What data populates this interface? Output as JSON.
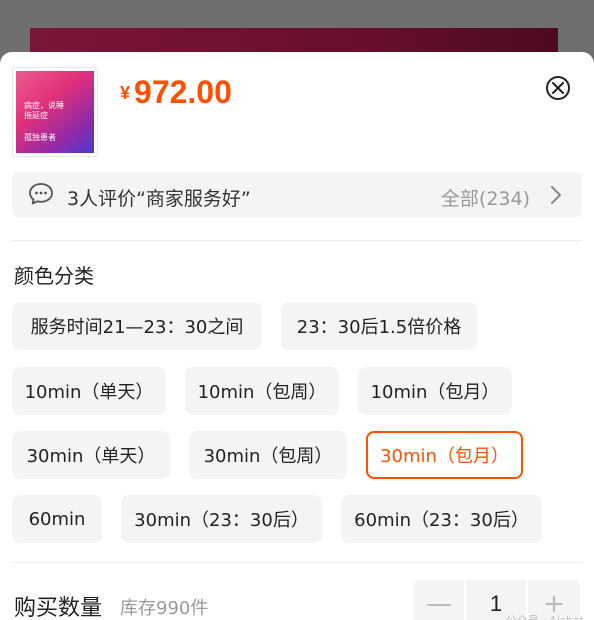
{
  "product": {
    "thumbnail_lines": [
      "病症，说睡",
      "拖延症",
      "孤独患者"
    ],
    "currency": "¥",
    "price": "972.00"
  },
  "review": {
    "text": "3人评价“商家服务好”",
    "all": "全部(234)"
  },
  "color_section": {
    "title": "颜色分类",
    "options": [
      "服务时间21—23：30之间",
      "23：30后1.5倍价格",
      "10min（单天）",
      "10min（包周）",
      "10min（包月）",
      "30min（单天）",
      "30min（包周）",
      "30min（包月）",
      "60min",
      "30min（23：30后）",
      "60min（23：30后）"
    ],
    "selected": "30min（包月）"
  },
  "quantity": {
    "label": "购买数量",
    "stock": "库存990件",
    "minus": "—",
    "value": "1",
    "plus": "+"
  },
  "watermark": "公众号 · Aichat"
}
